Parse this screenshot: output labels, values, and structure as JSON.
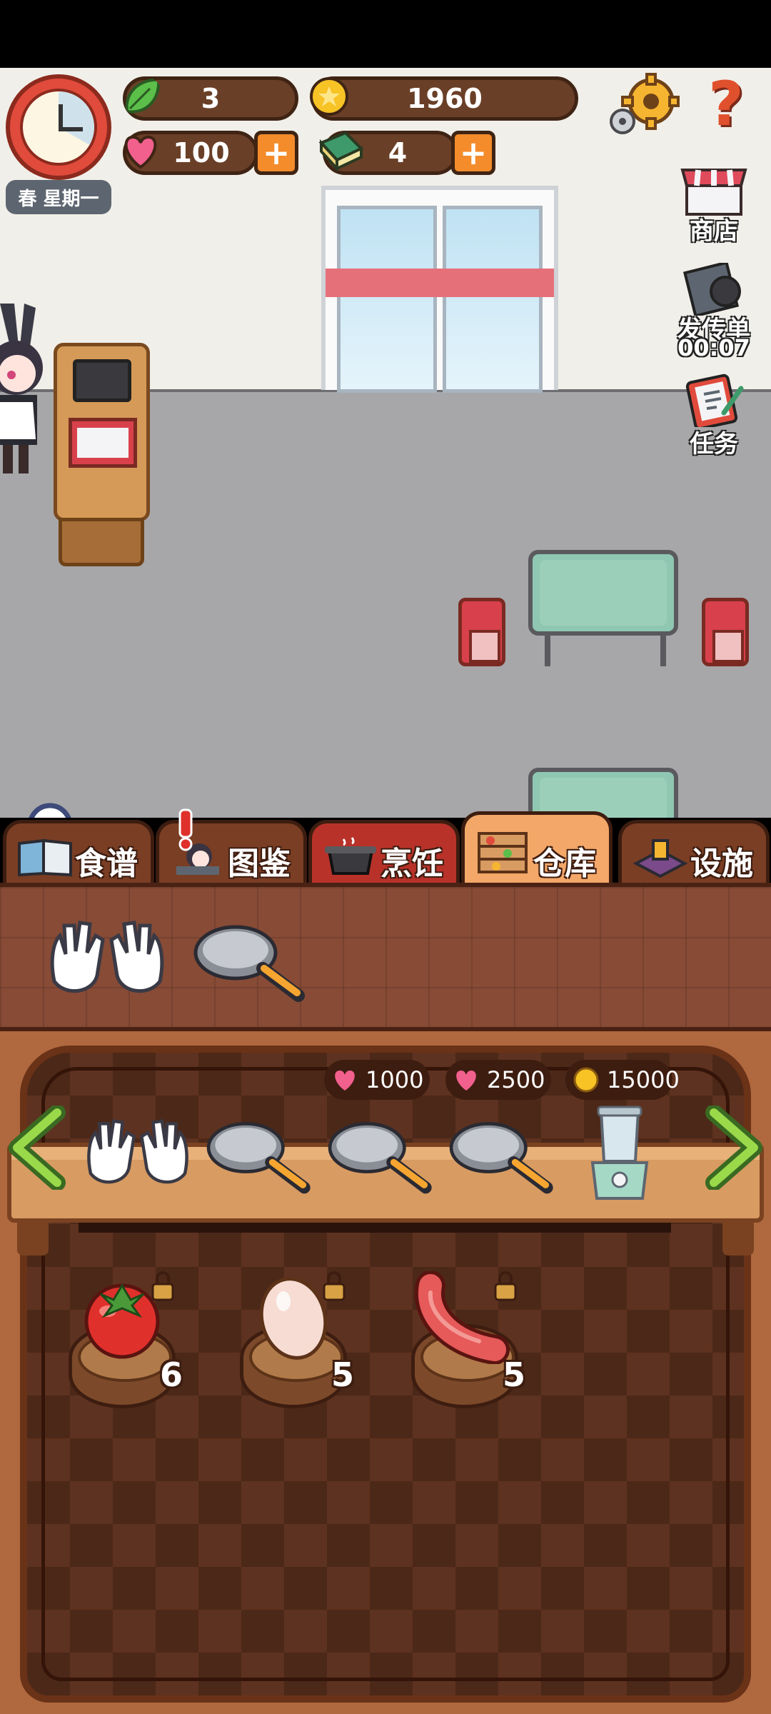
{
  "hud": {
    "season_day": "春 星期一",
    "leaf_count": "3",
    "coins": "1960",
    "hearts": "100",
    "books": "4",
    "plus": "+",
    "help": "?"
  },
  "side_menu": {
    "shop": "商店",
    "flyer": "发传单",
    "flyer_timer": "00:07",
    "tasks": "任务"
  },
  "tabs": [
    {
      "label": "食谱",
      "icon": "recipe-book-icon"
    },
    {
      "label": "图鉴",
      "icon": "encyclopedia-icon"
    },
    {
      "label": "烹饪",
      "icon": "cooking-pot-icon"
    },
    {
      "label": "仓库",
      "icon": "storage-shelf-icon",
      "active": true
    },
    {
      "label": "设施",
      "icon": "facility-icon"
    }
  ],
  "prices": [
    {
      "currency": "heart",
      "amount": "1000"
    },
    {
      "currency": "heart",
      "amount": "2500"
    },
    {
      "currency": "coin",
      "amount": "15000"
    }
  ],
  "tools": [
    "gloves",
    "frying-pan",
    "frying-pan",
    "frying-pan",
    "blender"
  ],
  "ingredients": [
    {
      "name": "tomato",
      "count": "6",
      "locked": true
    },
    {
      "name": "egg",
      "count": "5",
      "locked": true
    },
    {
      "name": "sausage",
      "count": "5",
      "locked": true
    }
  ],
  "colors": {
    "accent": "#f48c2b",
    "panel": "#6a3f27",
    "tab_active": "#f3a768"
  }
}
